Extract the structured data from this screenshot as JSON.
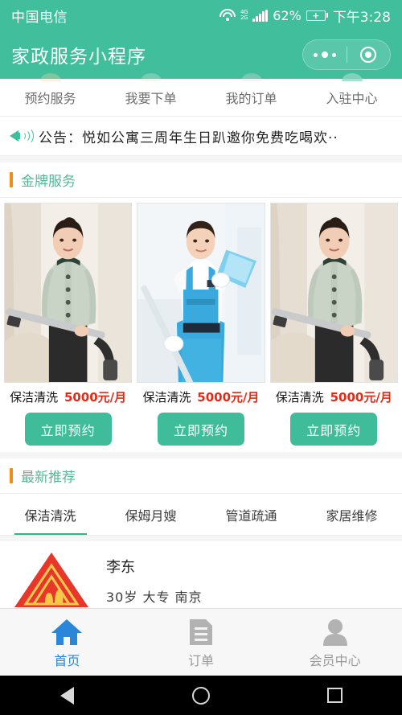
{
  "status_bar": {
    "carrier": "中国电信",
    "network_top": "4G",
    "network_bottom": "2G",
    "battery_percent": "62%",
    "time": "下午3:28",
    "icons": [
      "wifi-icon",
      "signal-icon",
      "battery-icon"
    ]
  },
  "app_bar": {
    "title": "家政服务小程序",
    "capsule": {
      "more_icon": "more-dots-icon",
      "close_icon": "target-circle-icon"
    }
  },
  "quick_nav": {
    "items": [
      {
        "label": "预约服务"
      },
      {
        "label": "我要下单"
      },
      {
        "label": "我的订单"
      },
      {
        "label": "入驻中心"
      }
    ]
  },
  "notice": {
    "icon": "megaphone-icon",
    "text": "公告：悦如公寓三周年生日趴邀你免费吃喝欢··"
  },
  "gold_section": {
    "title": "金牌服务",
    "accent_bar_color": "#ef8c1c",
    "title_color": "#57b896",
    "cards": [
      {
        "image_alt": "保洁阿姨手持吸尘器",
        "service": "保洁清洗",
        "price": "5000元/月",
        "button": "立即预约"
      },
      {
        "image_alt": "蓝色围裙保洁员手持拖把",
        "service": "保洁清洗",
        "price": "5000元/月",
        "button": "立即预约"
      },
      {
        "image_alt": "保洁阿姨手持吸尘器",
        "service": "保洁清洗",
        "price": "5000元/月",
        "button": "立即预约"
      }
    ]
  },
  "recommend_section": {
    "title": "最新推荐",
    "tabs": [
      {
        "label": "保洁清洗",
        "active": true
      },
      {
        "label": "保姆月嫂",
        "active": false
      },
      {
        "label": "管道疏通",
        "active": false
      },
      {
        "label": "家居维修",
        "active": false
      }
    ],
    "items": [
      {
        "logo": "red-house-logo",
        "name": "李东",
        "meta": "30岁 大专 南京"
      }
    ]
  },
  "tab_bar": {
    "items": [
      {
        "label": "首页",
        "icon": "home-icon",
        "active": true
      },
      {
        "label": "订单",
        "icon": "document-icon",
        "active": false
      },
      {
        "label": "会员中心",
        "icon": "user-icon",
        "active": false
      }
    ],
    "active_color": "#2a86d8",
    "inactive_color": "#9a9a9a"
  },
  "android_nav": {
    "back_icon": "triangle-back-icon",
    "home_icon": "circle-home-icon",
    "recents_icon": "square-recents-icon"
  },
  "theme": {
    "primary": "#41be9c",
    "button": "#3fbd9b",
    "price": "#e32b16",
    "accent": "#ef8c1c"
  }
}
